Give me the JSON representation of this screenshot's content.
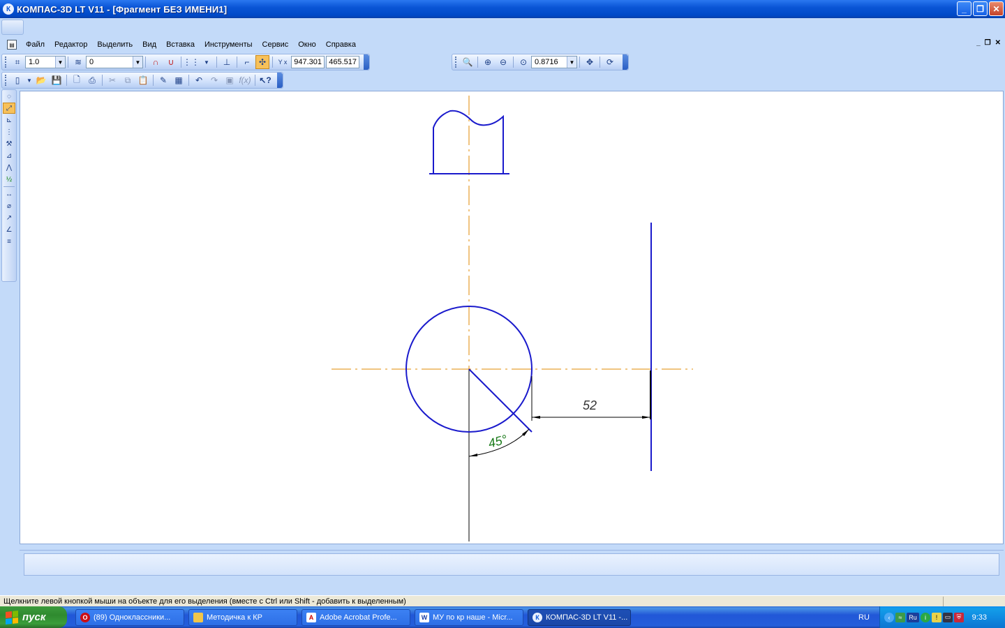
{
  "window": {
    "title": "КОМПАС-3D LT V11 - [Фрагмент БЕЗ ИМЕНИ1]",
    "app_icon": "К"
  },
  "menu": [
    {
      "label": "Файл"
    },
    {
      "label": "Редактор"
    },
    {
      "label": "Выделить"
    },
    {
      "label": "Вид"
    },
    {
      "label": "Вставка"
    },
    {
      "label": "Инструменты"
    },
    {
      "label": "Сервис"
    },
    {
      "label": "Окно"
    },
    {
      "label": "Справка"
    }
  ],
  "toolbar_current": {
    "step_value": "1.0",
    "layer_value": "0",
    "x_coord": "947.301",
    "y_coord": "465.517",
    "xy_label": "Y x"
  },
  "toolbar_view": {
    "zoom_value": "0.8716"
  },
  "drawing": {
    "dimension_linear": "52",
    "dimension_angle": "45°",
    "colors": {
      "main_line": "#1a1acc",
      "axis_line": "#e08a00",
      "dimension": "#000000",
      "angle_text": "#1a7a1a"
    }
  },
  "status": {
    "hint": "Щелкните левой кнопкой мыши на объекте для его выделения (вместе с Ctrl или Shift - добавить к выделенным)"
  },
  "taskbar": {
    "start_label": "пуск",
    "tasks": [
      {
        "label": "(89) Одноклассники...",
        "icon": "opera-icon"
      },
      {
        "label": "Методичка к КР",
        "icon": "folder-icon"
      },
      {
        "label": "Adobe Acrobat Profe...",
        "icon": "acrobat-icon"
      },
      {
        "label": "МУ по кр наше - Micr...",
        "icon": "word-icon"
      },
      {
        "label": "КОМПАС-3D LT V11 -...",
        "icon": "kompas-icon"
      }
    ],
    "lang": "RU",
    "tray_ru": "Ru",
    "clock": "9:33"
  }
}
